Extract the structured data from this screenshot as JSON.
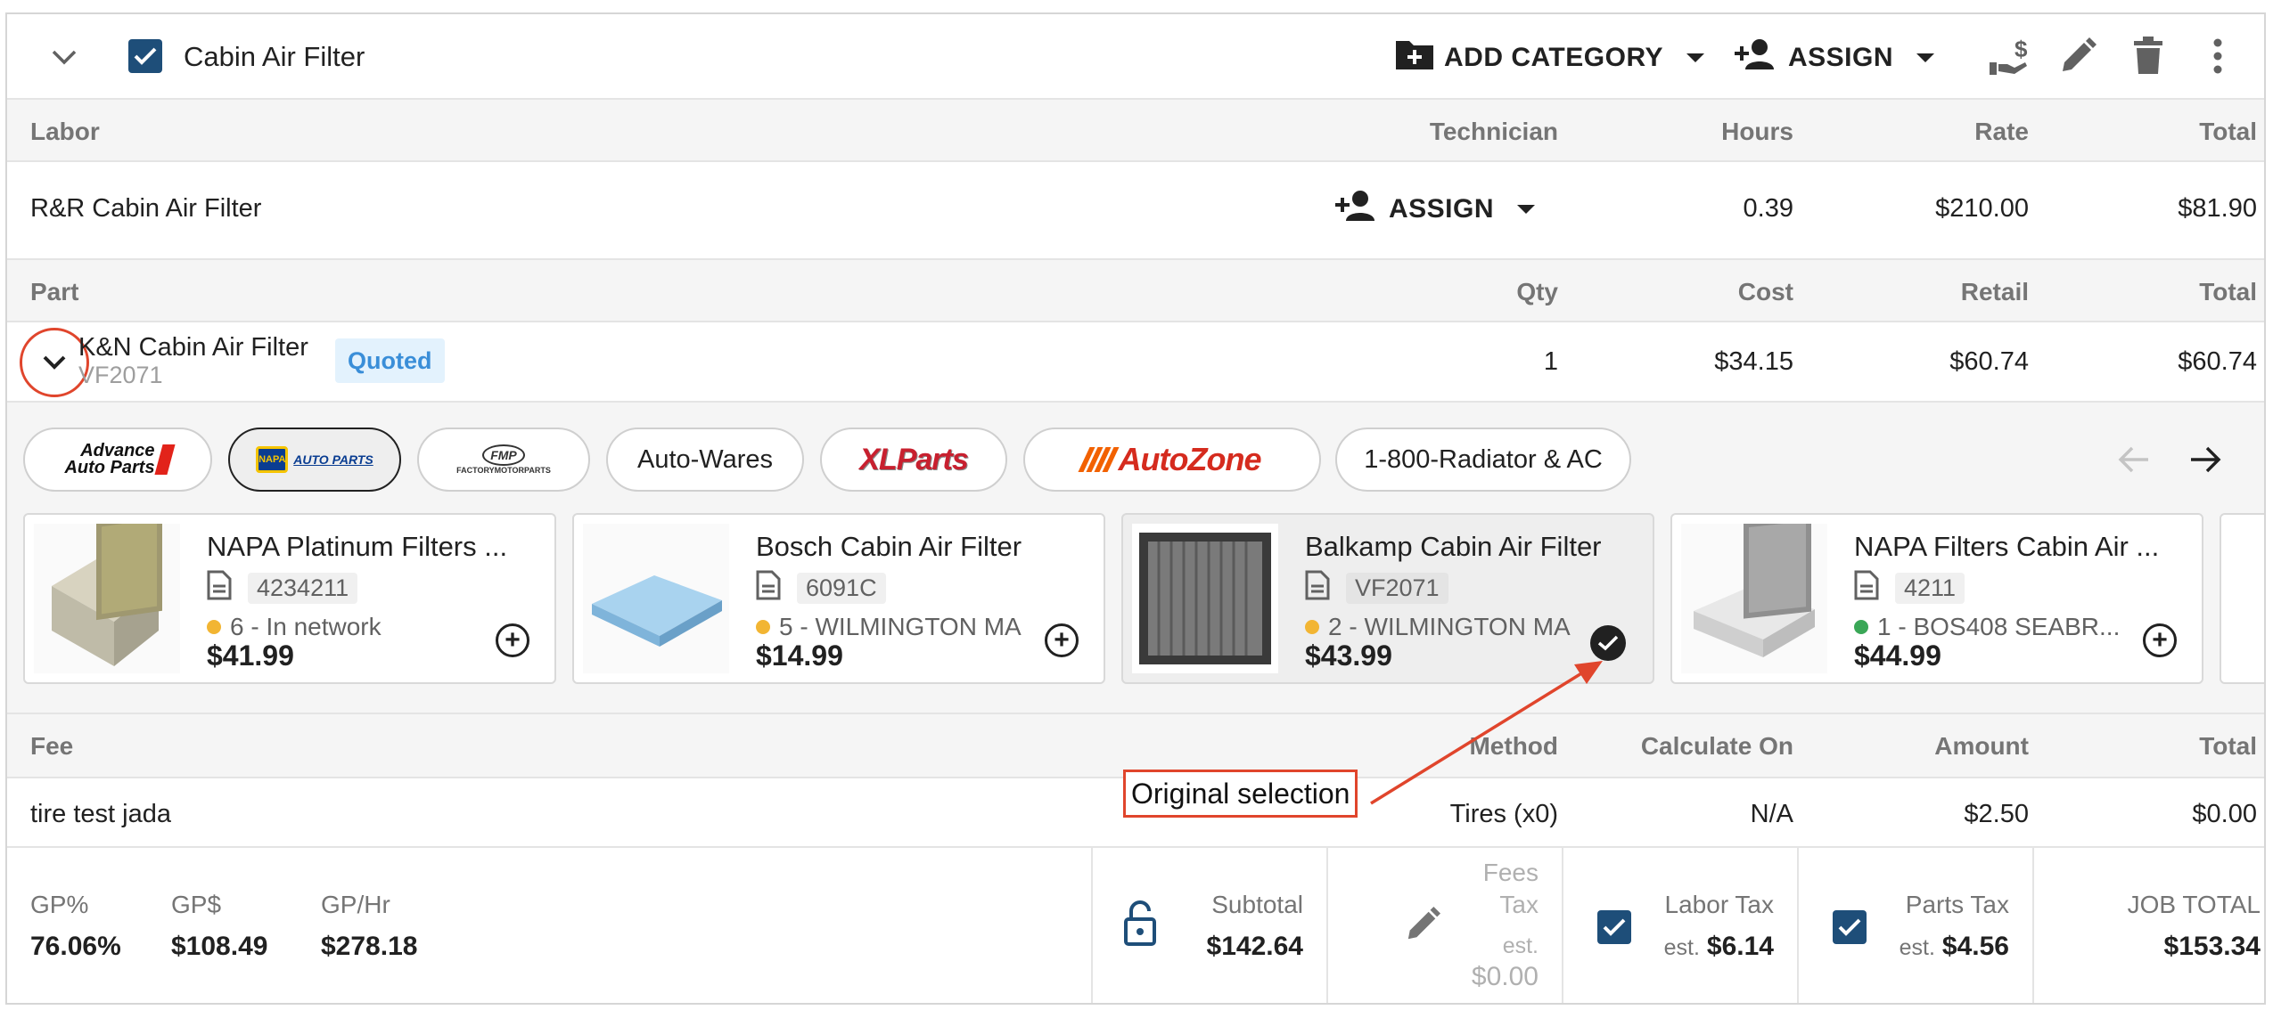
{
  "header": {
    "title": "Cabin Air Filter",
    "add_category": "ADD CATEGORY",
    "assign": "ASSIGN"
  },
  "labor": {
    "headers": {
      "name": "Labor",
      "technician": "Technician",
      "hours": "Hours",
      "rate": "Rate",
      "total": "Total"
    },
    "row": {
      "name": "R&R Cabin Air Filter",
      "assign": "ASSIGN",
      "hours": "0.39",
      "rate": "$210.00",
      "total": "$81.90"
    }
  },
  "part": {
    "headers": {
      "name": "Part",
      "qty": "Qty",
      "cost": "Cost",
      "retail": "Retail",
      "total": "Total"
    },
    "row": {
      "name": "K&N Cabin Air Filter",
      "number": "VF2071",
      "status": "Quoted",
      "qty": "1",
      "cost": "$34.15",
      "retail": "$60.74",
      "total": "$60.74"
    }
  },
  "vendors": [
    {
      "name": "Advance Auto Parts",
      "logo": "advance-logo",
      "logo_line1": "Advance",
      "logo_line2": "Auto Parts"
    },
    {
      "name": "NAPA Auto Parts",
      "logo": "napa-logo",
      "logo_text": "NAPA",
      "logo_sub": "AUTO PARTS",
      "selected": true
    },
    {
      "name": "Factory Motor Parts",
      "logo": "fmp-logo",
      "logo_text": "FMP",
      "logo_sub": "FACTORYMOTORPARTS"
    },
    {
      "name": "Auto-Wares",
      "label": "Auto-Wares"
    },
    {
      "name": "XL Parts",
      "logo": "xlparts-logo",
      "logo_text": "XLParts"
    },
    {
      "name": "AutoZone",
      "logo": "autozone-logo",
      "logo_text": "AutoZone"
    },
    {
      "name": "1-800-Radiator & AC",
      "label": "1-800-Radiator & AC"
    }
  ],
  "products": [
    {
      "name": "NAPA Platinum Filters ...",
      "pn": "4234211",
      "stock": "6 - In network",
      "stock_color": "#f2b533",
      "price": "$41.99",
      "img": "#c9c28f"
    },
    {
      "name": "Bosch Cabin Air Filter",
      "pn": "6091C",
      "stock": "5 - WILMINGTON MA",
      "stock_color": "#f2b533",
      "price": "$14.99",
      "img": "#a9d3ef"
    },
    {
      "name": "Balkamp Cabin Air Filter",
      "pn": "VF2071",
      "stock": "2 - WILMINGTON MA",
      "stock_color": "#f2b533",
      "price": "$43.99",
      "img": "#6b6b6b",
      "selected": true
    },
    {
      "name": "NAPA Filters Cabin Air ...",
      "pn": "4211",
      "stock": "1 - BOS408 SEABR...",
      "stock_color": "#3aa757",
      "price": "$44.99",
      "img": "#9a9a9a"
    }
  ],
  "fee": {
    "headers": {
      "name": "Fee",
      "method": "Method",
      "calc": "Calculate On",
      "amount": "Amount",
      "total": "Total"
    },
    "row": {
      "name": "tire test jada",
      "method": "Tires (x0)",
      "calc": "N/A",
      "amount": "$2.50",
      "total": "$0.00"
    }
  },
  "annotation": "Original selection",
  "summary": {
    "gp_pct_label": "GP%",
    "gp_pct": "76.06%",
    "gp_dollar_label": "GP$",
    "gp_dollar": "$108.49",
    "gp_hr_label": "GP/Hr",
    "gp_hr": "$278.18",
    "subtotal_label": "Subtotal",
    "subtotal": "$142.64",
    "fees_tax_label1": "Fees",
    "fees_tax_label2": "Tax",
    "fees_tax_est": "est.",
    "fees_tax": "$0.00",
    "labor_tax_label": "Labor Tax",
    "labor_tax_est": "est.",
    "labor_tax": "$6.14",
    "parts_tax_label": "Parts Tax",
    "parts_tax_est": "est.",
    "parts_tax": "$4.56",
    "job_total_label": "JOB TOTAL",
    "job_total": "$153.34"
  },
  "colors": {
    "accent": "#1e4e79",
    "annotation": "#e0452c",
    "quoted_bg": "#e3f2fd",
    "quoted_text": "#3a8ed8"
  }
}
